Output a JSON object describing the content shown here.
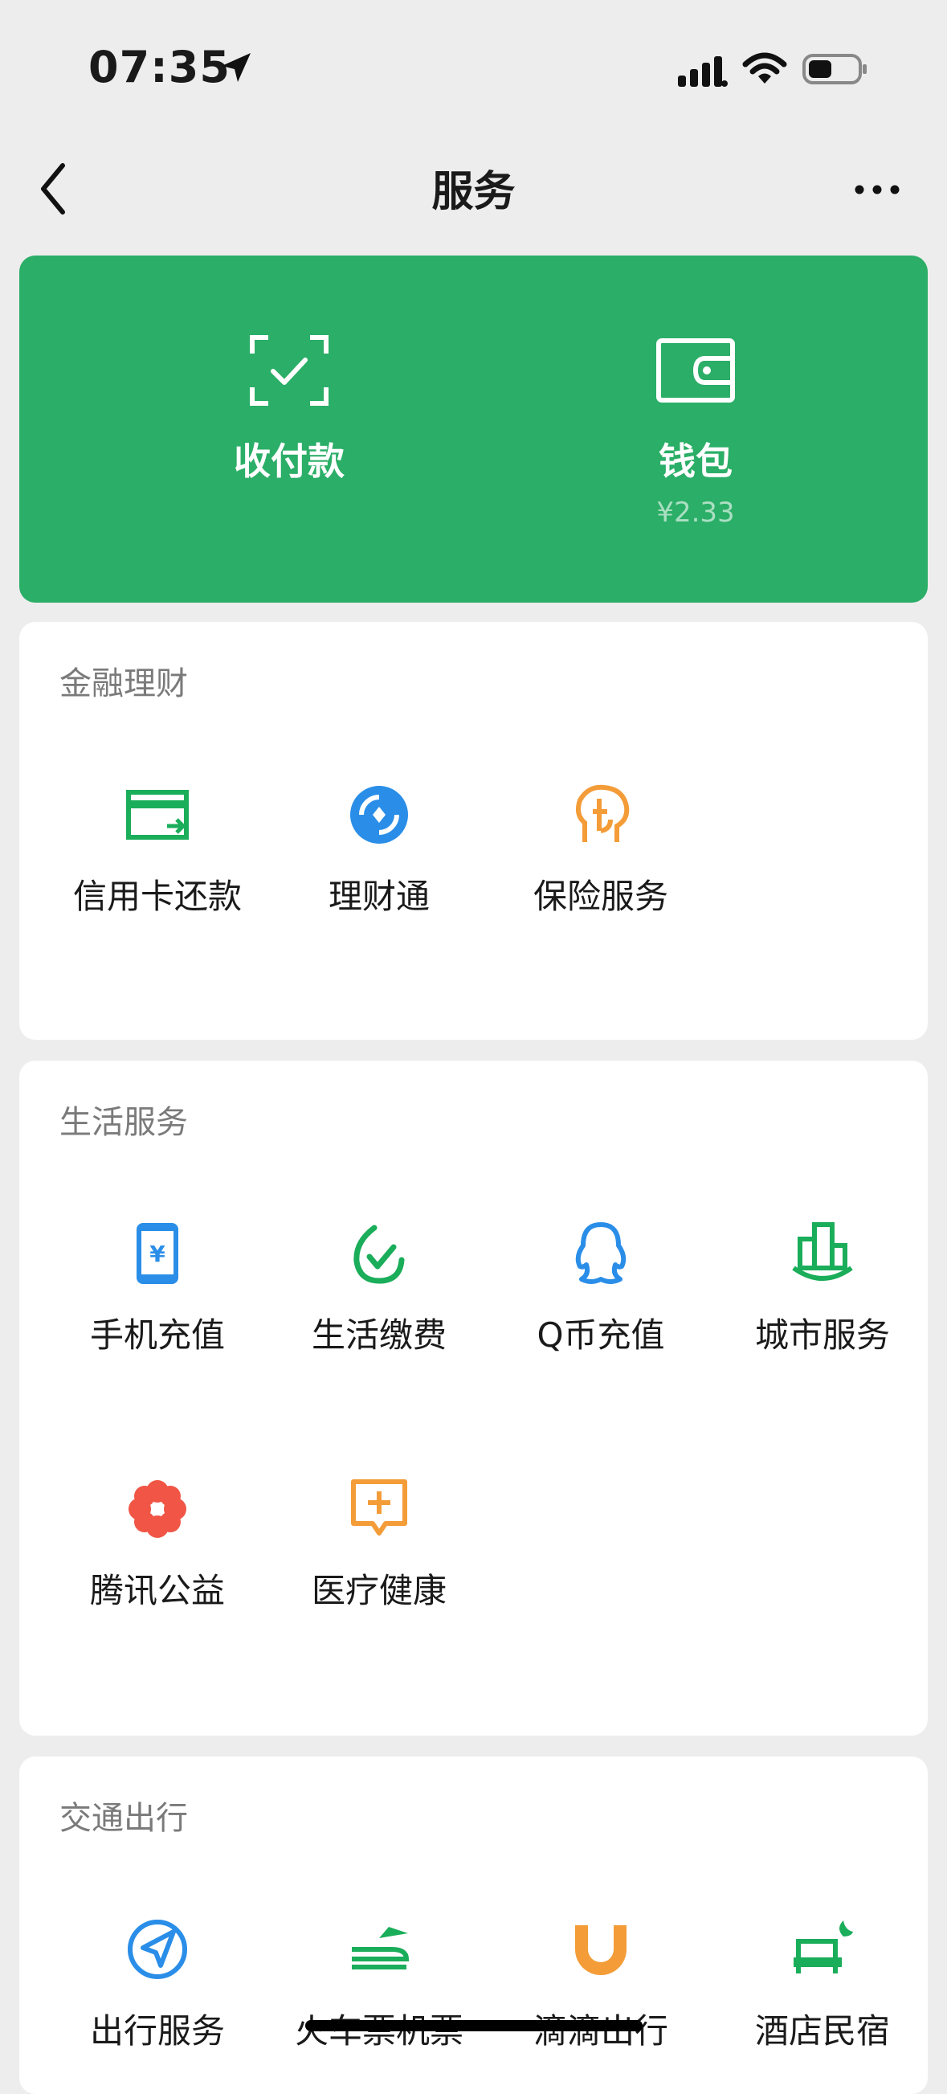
{
  "status_bar": {
    "time": "07:35"
  },
  "nav": {
    "title": "服务"
  },
  "hero": {
    "pay": {
      "label": "收付款"
    },
    "wallet": {
      "label": "钱包",
      "balance": "¥2.33"
    },
    "color": "#2bae67"
  },
  "sections": [
    {
      "title": "金融理财",
      "items": [
        {
          "label": "信用卡还款",
          "icon": "credit-card-icon"
        },
        {
          "label": "理财通",
          "icon": "wealth-icon"
        },
        {
          "label": "保险服务",
          "icon": "insurance-icon"
        }
      ]
    },
    {
      "title": "生活服务",
      "items": [
        {
          "label": "手机充值",
          "icon": "phone-topup-icon"
        },
        {
          "label": "生活缴费",
          "icon": "utility-payment-icon"
        },
        {
          "label": "Q币充值",
          "icon": "qq-coin-icon"
        },
        {
          "label": "城市服务",
          "icon": "city-services-icon"
        },
        {
          "label": "腾讯公益",
          "icon": "tencent-charity-icon"
        },
        {
          "label": "医疗健康",
          "icon": "medical-health-icon"
        }
      ]
    },
    {
      "title": "交通出行",
      "items": [
        {
          "label": "出行服务",
          "icon": "travel-services-icon"
        },
        {
          "label": "火车票机票",
          "icon": "train-plane-icon"
        },
        {
          "label": "滴滴出行",
          "icon": "didi-icon"
        },
        {
          "label": "酒店民宿",
          "icon": "hotel-icon"
        }
      ]
    }
  ]
}
